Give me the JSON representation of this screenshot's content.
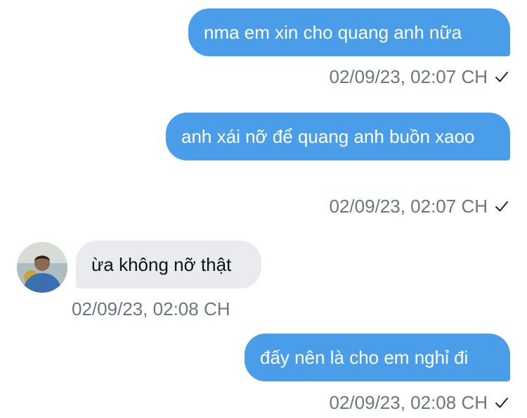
{
  "messages": [
    {
      "text": "nma em xin cho quang anh nữa",
      "time": "02/09/23, 02:07 CH"
    },
    {
      "text": "anh xái nỡ để quang anh buồn xaoo",
      "time": "02/09/23, 02:07 CH"
    },
    {
      "text": "ừa không nỡ thật",
      "time": "02/09/23, 02:08 CH"
    },
    {
      "text": "đấy nên là cho em nghỉ đi",
      "time": "02/09/23, 02:08 CH"
    }
  ],
  "colors": {
    "outgoing_bubble": "#4a9ee9",
    "incoming_bubble": "#e9ebef",
    "timestamp": "#6b7682",
    "background": "#ffffff"
  },
  "icons": {
    "read_receipt": "check-icon",
    "contact_avatar": "avatar"
  }
}
